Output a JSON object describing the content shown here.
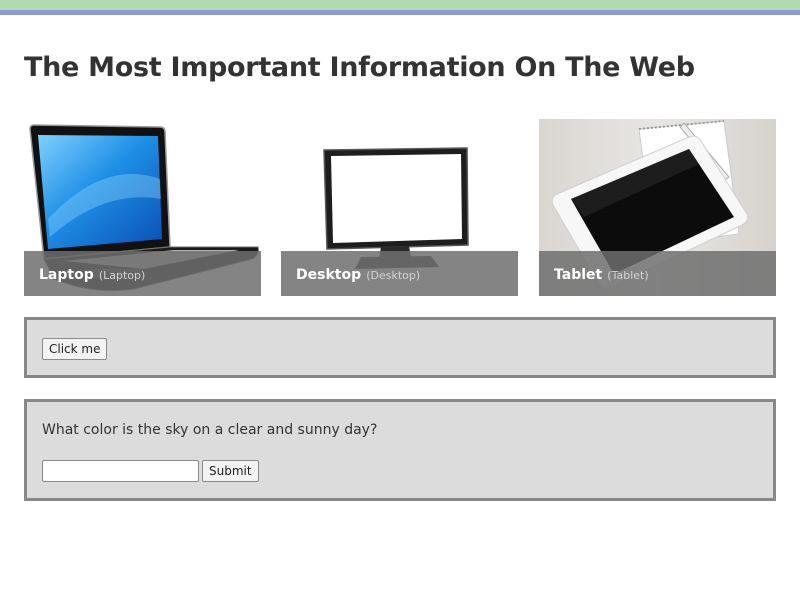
{
  "page": {
    "title": "The Most Important Information On The Web"
  },
  "devices": [
    {
      "name": "Laptop",
      "subtitle": "(Laptop)",
      "icon": "laptop-image"
    },
    {
      "name": "Desktop",
      "subtitle": "(Desktop)",
      "icon": "desktop-monitor-image"
    },
    {
      "name": "Tablet",
      "subtitle": "(Tablet)",
      "icon": "tablet-image"
    }
  ],
  "button_panel": {
    "button_label": "Click me"
  },
  "quiz": {
    "question": "What color is the sky on a clear and sunny day?",
    "answer_value": "",
    "answer_placeholder": "",
    "submit_label": "Submit"
  },
  "colors": {
    "top_bar_green": "#b2dab1",
    "top_bar_blue": "#8e9bd1",
    "panel_background": "#dcdcdc",
    "panel_border": "#888888",
    "caption_overlay": "#6e6e6e"
  }
}
